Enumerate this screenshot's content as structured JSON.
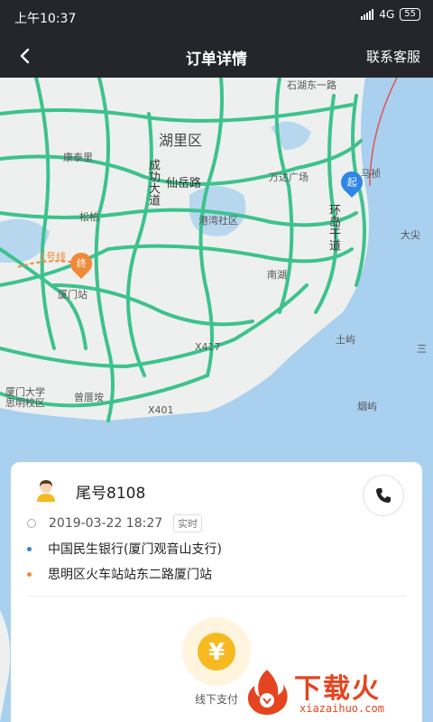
{
  "status_bar": {
    "time": "上午10:37",
    "network": "4G",
    "battery": "55"
  },
  "nav": {
    "title": "订单详情",
    "action": "联系客服",
    "back_icon": "chevron-left-icon"
  },
  "map": {
    "labels": {
      "huli": "湖里区",
      "kangtai": "康泰里",
      "songbai": "松柏",
      "xianyue": "仙岳路",
      "chenggong": "成功大道",
      "wanda": "万达广场",
      "qiao": "港湾社区",
      "nanhu": "南湖",
      "huandao": "环岛干道",
      "dajian": "大尖",
      "tuyu": "土屿",
      "sansan": "三",
      "yanyu": "烟屿",
      "zengcuoan": "曾厝垵",
      "siming": "思明校区",
      "xiada": "厦门大学",
      "xiamen_station": "厦门站",
      "x417": "X417",
      "x401": "X401",
      "line1": "1号线",
      "majiao": "马祯",
      "shiji": "石湖东一路"
    },
    "start_pin": "起",
    "end_pin": "终"
  },
  "order": {
    "tail_number": "尾号8108",
    "datetime": "2019-03-22 18:27",
    "tag": "实时",
    "origin": "中国民生银行(厦门观音山支行)",
    "destination": "思明区火车站站东二路厦门站",
    "payment_label": "线下支付",
    "payment_symbol": "¥"
  },
  "watermark": {
    "title": "下载火",
    "url": "xiazaihuo.com"
  },
  "colors": {
    "header": "#24262c",
    "road": "#3cc28d",
    "sea": "#a9d0ee",
    "land": "#eef0ef",
    "pay": "#f6b91f",
    "watermark": "#e4451f"
  }
}
